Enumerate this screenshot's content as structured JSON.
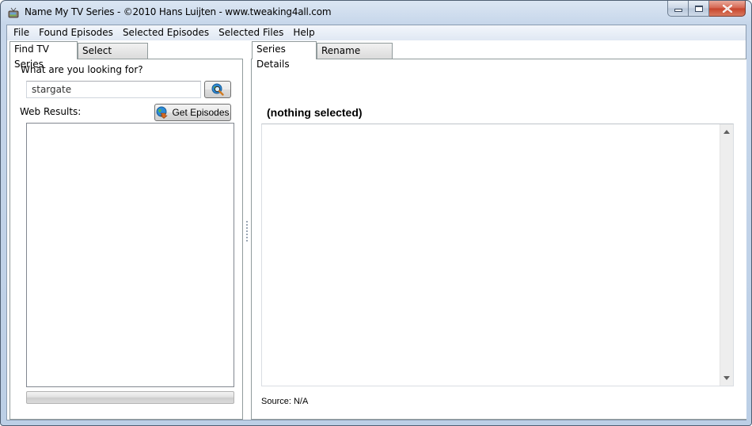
{
  "window": {
    "title": "Name My TV Series - ©2010 Hans Luijten - www.tweaking4all.com",
    "icon": "tv-icon"
  },
  "menubar": {
    "items": [
      {
        "label": "File"
      },
      {
        "label": "Found Episodes"
      },
      {
        "label": "Selected Episodes"
      },
      {
        "label": "Selected Files"
      },
      {
        "label": "Help"
      }
    ]
  },
  "left_tabs": [
    {
      "label": "Find TV Series",
      "active": true
    },
    {
      "label": "Select Episodes",
      "active": false
    }
  ],
  "right_tabs": [
    {
      "label": "Series Details",
      "active": true
    },
    {
      "label": "Rename Scheme",
      "active": false
    }
  ],
  "find_series": {
    "prompt_label": "What are you looking for?",
    "search_value": "stargate",
    "search_button_icon": "globe-search-icon",
    "web_results_label": "Web Results:",
    "get_episodes_label": "Get Episodes",
    "get_episodes_icon": "globe-download-icon",
    "results": [],
    "progress_percent": 0
  },
  "series_details": {
    "heading": "(nothing selected)",
    "source_label": "Source: N/A"
  }
}
